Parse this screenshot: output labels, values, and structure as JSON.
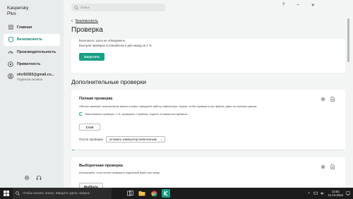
{
  "app": {
    "name_line1": "Kaspersky",
    "name_line2": "Plus"
  },
  "sidebar": {
    "items": [
      {
        "label": "Главная"
      },
      {
        "label": "Безопасность"
      },
      {
        "label": "Производительность"
      },
      {
        "label": "Приватность"
      }
    ],
    "account": {
      "email": "efor50365@gmail.co...",
      "status": "Подписка активна"
    }
  },
  "topbar": {
    "search_placeholder": "Поиск",
    "help": "?",
    "minimize": "–",
    "close": "✕"
  },
  "header": {
    "back_label": "Безопасность",
    "title": "Проверка"
  },
  "quick_card": {
    "line1": "Безопасно: угроз не обнаружено",
    "line2": "Быстрая проверка остановлена 4 дня назад на 1 %",
    "run_label": "Запустить"
  },
  "section_title": "Дополнительные проверки",
  "full_scan": {
    "title": "Полная проверка",
    "description": "Обычно занимает значительное время и может замедлить работу компьютера. Нужна, чтобы проверить все файлы, даже на съемных дисках",
    "status": "Выполняется проверка. 1 %, проверено 0 файлов, подсчет оставшегося времени...",
    "stop_label": "Стоп",
    "after_label": "После проверки",
    "after_value": "оставить компьютер включенным",
    "progress_fraction": 0.01
  },
  "selective_scan": {
    "title": "Выборочная проверка",
    "description": "Используйте, если хотите проверить отдельный файл или папку.",
    "choose_label": "Выбрать"
  },
  "taskbar": {
    "search_placeholder": "Чтобы начать поиск, введите здесь запрос",
    "time": "13:52",
    "date": "12.10.2024"
  },
  "colors": {
    "accent": "#16a086",
    "sidebar_bg": "#e9ecec",
    "page_bg": "#f3f4f4",
    "taskbar_bg": "#1c1c1c"
  }
}
